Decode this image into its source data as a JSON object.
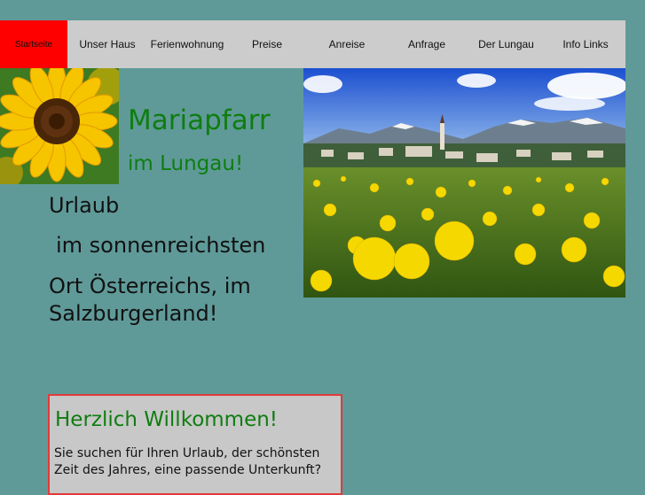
{
  "nav": {
    "items": [
      {
        "label": "Startseite"
      },
      {
        "label": "Unser Haus"
      },
      {
        "label": "Ferienwohnung"
      },
      {
        "label": "Preise"
      },
      {
        "label": "Anreise"
      },
      {
        "label": "Anfrage"
      },
      {
        "label": "Der Lungau"
      },
      {
        "label": "Info Links"
      }
    ],
    "active_color": "#ff0000",
    "bar_color": "#cccccc"
  },
  "header": {
    "title": "Mariapfarr",
    "subtitle": "im Lungau!"
  },
  "intro": {
    "line1": "Urlaub",
    "line2": "im sonnenreichsten",
    "line3": "Ort Österreichs, im",
    "line4": "Salzburgerland!"
  },
  "welcome": {
    "heading": "Herzlich Willkommen!",
    "text": "Sie suchen für Ihren Urlaub, der schönsten Zeit des Jahres, eine passende Unterkunft?"
  },
  "colors": {
    "background": "#5f9a99",
    "heading_green": "#0f7d10",
    "box_border": "#e23a3a"
  }
}
